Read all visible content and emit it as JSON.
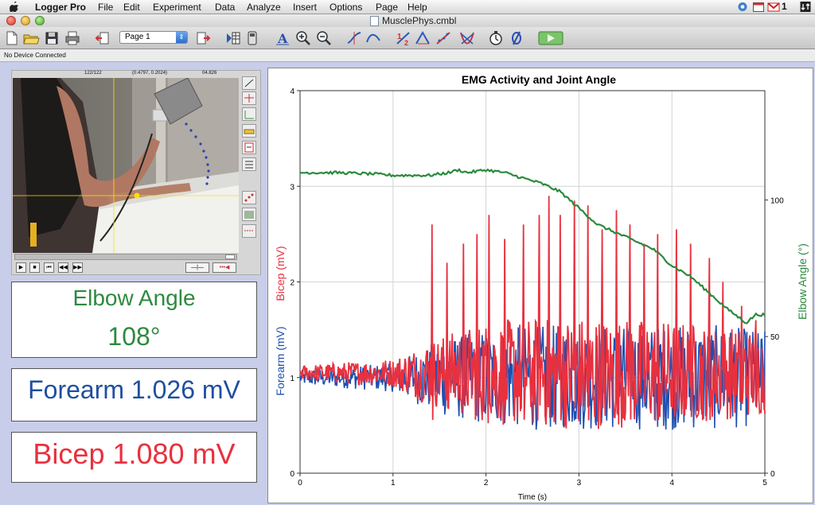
{
  "menubar": {
    "app_name": "Logger Pro",
    "menus": [
      "File",
      "Edit",
      "Experiment",
      "Data",
      "Analyze",
      "Insert",
      "Options",
      "Page",
      "Help"
    ],
    "gmail_count": "1"
  },
  "window": {
    "title": "MusclePhys.cmbl"
  },
  "toolbar": {
    "page_select": "Page 1"
  },
  "status": {
    "device": "No Device Connected"
  },
  "video": {
    "frame": "122/122",
    "coords": "(0.4797, 0.2024)",
    "time": "04.826"
  },
  "meters": {
    "elbow": {
      "label": "Elbow Angle",
      "value": "108°",
      "color": "#2d8a3e"
    },
    "forearm": {
      "text": "Forearm 1.026 mV",
      "color": "#1f4f9f"
    },
    "bicep": {
      "text": "Bicep 1.080 mV",
      "color": "#e8313f"
    }
  },
  "chart_data": {
    "type": "line",
    "title": "EMG Activity and Joint Angle",
    "xlabel": "Time (s)",
    "xlim": [
      0,
      5
    ],
    "x_ticks": [
      "0",
      "1",
      "2",
      "3",
      "4",
      "5"
    ],
    "y_left_ticks": [
      "0",
      "1",
      "2",
      "3",
      "4"
    ],
    "ylim_left": [
      0,
      4
    ],
    "ylabel_left_top": "Bicep (mV)",
    "ylabel_left_bottom": "Forearm (mV)",
    "y_right_ticks": [
      "0",
      "50",
      "100"
    ],
    "ylim_right": [
      0,
      140
    ],
    "ylabel_right": "Elbow Angle (°)",
    "grid": true,
    "series": [
      {
        "name": "Elbow Angle",
        "axis": "right",
        "color": "#2a8a3d",
        "x": [
          0.0,
          0.4,
          0.8,
          1.0,
          1.2,
          1.4,
          1.6,
          1.7,
          1.8,
          2.0,
          2.2,
          2.4,
          2.6,
          2.8,
          3.0,
          3.2,
          3.4,
          3.6,
          3.8,
          4.0,
          4.2,
          4.4,
          4.6,
          4.8,
          4.9,
          5.0
        ],
        "values": [
          110,
          110,
          109.5,
          109,
          109,
          109,
          110,
          111,
          110,
          111,
          110,
          108,
          106,
          103,
          97,
          91,
          88,
          85,
          82,
          76,
          72,
          66,
          60,
          55,
          58,
          58
        ]
      },
      {
        "name": "Forearm",
        "axis": "left",
        "color": "#1f4fb0",
        "x_range": [
          0,
          5
        ],
        "noisy": true,
        "envelope": [
          [
            0,
            0.08
          ],
          [
            1.0,
            0.15
          ],
          [
            1.5,
            0.4
          ],
          [
            2.0,
            0.5
          ],
          [
            2.5,
            0.55
          ],
          [
            3.0,
            0.55
          ],
          [
            3.5,
            0.55
          ],
          [
            4.0,
            0.55
          ],
          [
            4.5,
            0.55
          ],
          [
            5.0,
            0.5
          ]
        ],
        "baseline": 1.0
      },
      {
        "name": "Bicep",
        "axis": "left",
        "color": "#e8313f",
        "x_range": [
          0,
          5
        ],
        "noisy": true,
        "baseline": 1.05,
        "peaks": [
          {
            "x": 1.42,
            "y": 2.6
          },
          {
            "x": 1.58,
            "y": 2.2
          },
          {
            "x": 1.76,
            "y": 2.4
          },
          {
            "x": 1.9,
            "y": 2.5
          },
          {
            "x": 2.03,
            "y": 2.7
          },
          {
            "x": 2.2,
            "y": 2.45
          },
          {
            "x": 2.4,
            "y": 2.6
          },
          {
            "x": 2.57,
            "y": 2.7
          },
          {
            "x": 2.68,
            "y": 2.9
          },
          {
            "x": 2.8,
            "y": 2.7
          },
          {
            "x": 2.95,
            "y": 2.85
          },
          {
            "x": 3.1,
            "y": 2.8
          },
          {
            "x": 3.25,
            "y": 2.55
          },
          {
            "x": 3.4,
            "y": 2.75
          },
          {
            "x": 3.55,
            "y": 2.6
          },
          {
            "x": 3.7,
            "y": 2.4
          },
          {
            "x": 3.85,
            "y": 2.5
          },
          {
            "x": 4.05,
            "y": 2.55
          },
          {
            "x": 4.2,
            "y": 2.4
          },
          {
            "x": 4.4,
            "y": 2.25
          },
          {
            "x": 4.55,
            "y": 2.0
          },
          {
            "x": 4.75,
            "y": 1.75
          },
          {
            "x": 4.9,
            "y": 1.6
          }
        ]
      }
    ]
  }
}
